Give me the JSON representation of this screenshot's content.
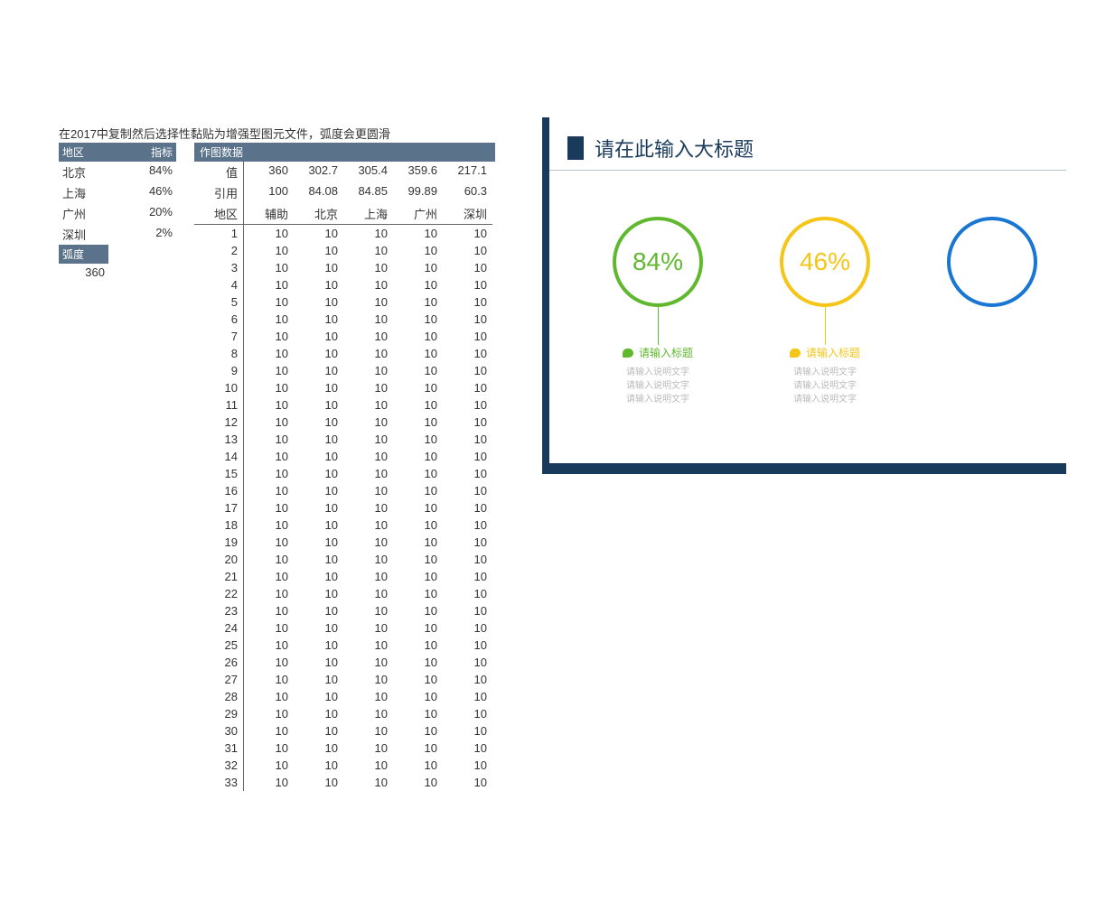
{
  "note": "在2017中复制然后选择性黏贴为增强型图元文件，弧度会更圆滑",
  "indicator": {
    "header_region": "地区",
    "header_metric": "指标",
    "rows": [
      {
        "region": "北京",
        "value": "84%"
      },
      {
        "region": "上海",
        "value": "46%"
      },
      {
        "region": "广州",
        "value": "20%"
      },
      {
        "region": "深圳",
        "value": "2%"
      }
    ],
    "arc_header": "弧度",
    "arc_value": "360"
  },
  "plot": {
    "header": "作图数据",
    "row_value_label": "值",
    "row_value": [
      "360",
      "302.7",
      "305.4",
      "359.6",
      "217.1"
    ],
    "row_ref_label": "引用",
    "row_ref": [
      "100",
      "84.08",
      "84.85",
      "99.89",
      "60.3"
    ],
    "row_region_label": "地区",
    "row_region": [
      "辅助",
      "北京",
      "上海",
      "广州",
      "深圳"
    ],
    "body_count": 33,
    "body_value": "10"
  },
  "chart": {
    "title": "请在此输入大标题",
    "items": [
      {
        "pct": "84%",
        "color": "green",
        "label": "请输入标题",
        "desc1": "请输入说明文字",
        "desc2": "请输入说明文字",
        "desc3": "请输入说明文字"
      },
      {
        "pct": "46%",
        "color": "yellow",
        "label": "请输入标题",
        "desc1": "请输入说明文字",
        "desc2": "请输入说明文字",
        "desc3": "请输入说明文字"
      },
      {
        "pct": "",
        "color": "blue",
        "label": "",
        "desc1": "",
        "desc2": "",
        "desc3": ""
      }
    ]
  },
  "chart_data": {
    "type": "bar",
    "title": "请在此输入大标题",
    "categories": [
      "北京",
      "上海",
      "广州",
      "深圳"
    ],
    "values": [
      84,
      46,
      20,
      2
    ],
    "ylabel": "指标 (%)",
    "ylim": [
      0,
      100
    ]
  }
}
